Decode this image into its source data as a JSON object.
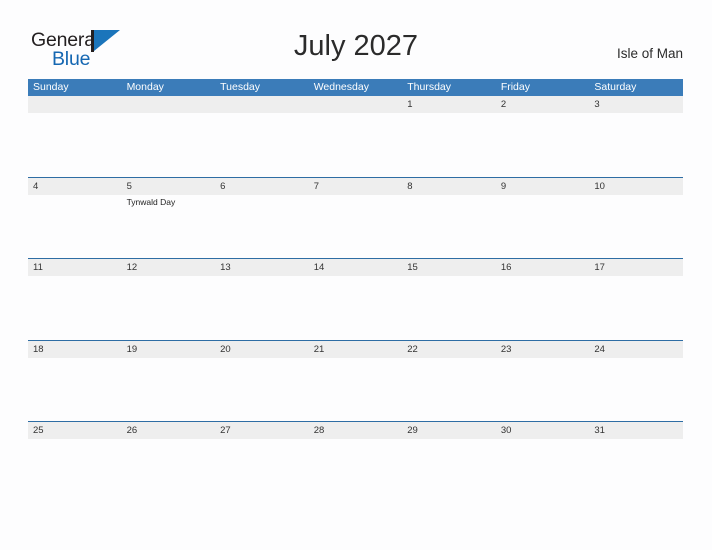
{
  "brand": {
    "word_one": "General",
    "word_two": "Blue",
    "flag_icon": "flag-triangle-icon"
  },
  "header": {
    "title": "July 2027",
    "region": "Isle of Man"
  },
  "colors": {
    "header_blue": "#3b7cb9",
    "row_divider_blue": "#2e6da4",
    "date_band_gray": "#eeeeee",
    "brand_blue": "#1567b2",
    "page_background": "#fdfdfe"
  },
  "calendar": {
    "weekdays": [
      "Sunday",
      "Monday",
      "Tuesday",
      "Wednesday",
      "Thursday",
      "Friday",
      "Saturday"
    ],
    "weeks": [
      {
        "days": [
          {
            "date": "",
            "event": ""
          },
          {
            "date": "",
            "event": ""
          },
          {
            "date": "",
            "event": ""
          },
          {
            "date": "",
            "event": ""
          },
          {
            "date": "1",
            "event": ""
          },
          {
            "date": "2",
            "event": ""
          },
          {
            "date": "3",
            "event": ""
          }
        ]
      },
      {
        "days": [
          {
            "date": "4",
            "event": ""
          },
          {
            "date": "5",
            "event": "Tynwald Day"
          },
          {
            "date": "6",
            "event": ""
          },
          {
            "date": "7",
            "event": ""
          },
          {
            "date": "8",
            "event": ""
          },
          {
            "date": "9",
            "event": ""
          },
          {
            "date": "10",
            "event": ""
          }
        ]
      },
      {
        "days": [
          {
            "date": "11",
            "event": ""
          },
          {
            "date": "12",
            "event": ""
          },
          {
            "date": "13",
            "event": ""
          },
          {
            "date": "14",
            "event": ""
          },
          {
            "date": "15",
            "event": ""
          },
          {
            "date": "16",
            "event": ""
          },
          {
            "date": "17",
            "event": ""
          }
        ]
      },
      {
        "days": [
          {
            "date": "18",
            "event": ""
          },
          {
            "date": "19",
            "event": ""
          },
          {
            "date": "20",
            "event": ""
          },
          {
            "date": "21",
            "event": ""
          },
          {
            "date": "22",
            "event": ""
          },
          {
            "date": "23",
            "event": ""
          },
          {
            "date": "24",
            "event": ""
          }
        ]
      },
      {
        "days": [
          {
            "date": "25",
            "event": ""
          },
          {
            "date": "26",
            "event": ""
          },
          {
            "date": "27",
            "event": ""
          },
          {
            "date": "28",
            "event": ""
          },
          {
            "date": "29",
            "event": ""
          },
          {
            "date": "30",
            "event": ""
          },
          {
            "date": "31",
            "event": ""
          }
        ]
      }
    ]
  }
}
